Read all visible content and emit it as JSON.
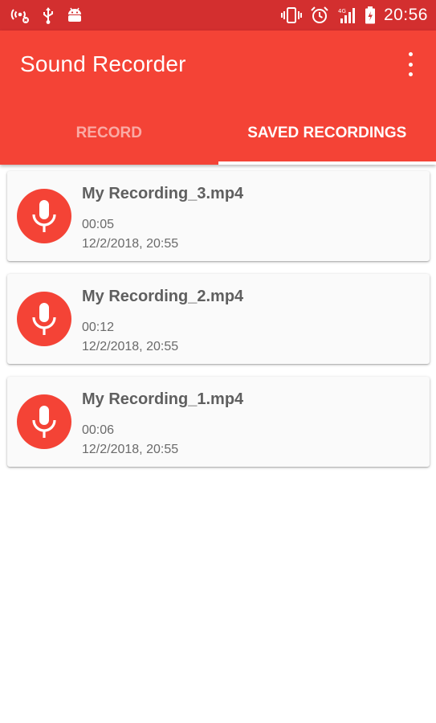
{
  "status_bar": {
    "time": "20:56",
    "icons_left": [
      "wireless-hotspot-icon",
      "usb-icon",
      "android-debug-icon"
    ],
    "icons_right": [
      "vibrate-icon",
      "alarm-icon",
      "signal-4g-icon",
      "battery-charging-icon"
    ]
  },
  "app_bar": {
    "title": "Sound Recorder",
    "overflow_icon": "more-vert-icon"
  },
  "tabs": [
    {
      "label": "RECORD",
      "active": false
    },
    {
      "label": "SAVED RECORDINGS",
      "active": true
    }
  ],
  "recordings": [
    {
      "name": "My Recording_3.mp4",
      "length": "00:05",
      "date": "12/2/2018, 20:55",
      "icon": "microphone-icon"
    },
    {
      "name": "My Recording_2.mp4",
      "length": "00:12",
      "date": "12/2/2018, 20:55",
      "icon": "microphone-icon"
    },
    {
      "name": "My Recording_1.mp4",
      "length": "00:06",
      "date": "12/2/2018, 20:55",
      "icon": "microphone-icon"
    }
  ],
  "colors": {
    "status_bar": "#d32f2f",
    "primary": "#f44336",
    "card_background": "#fafafa",
    "text_primary": "#5f5f5f",
    "text_secondary": "#6a6a6a"
  }
}
